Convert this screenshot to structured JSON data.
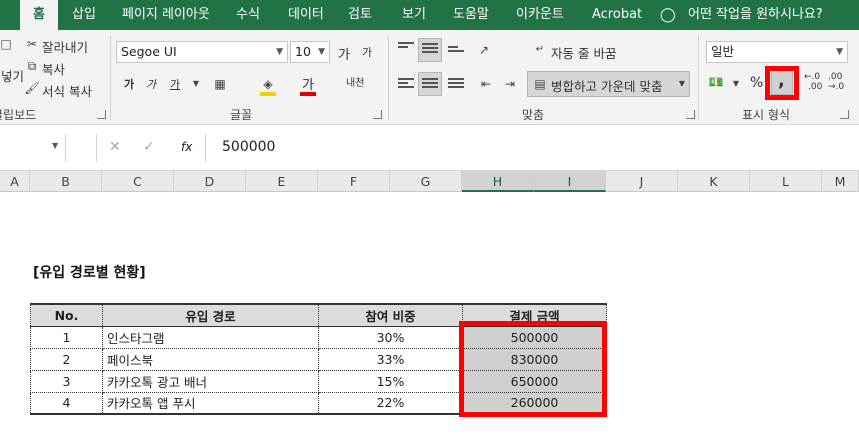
{
  "tabs": [
    "홈",
    "삽입",
    "페이지 레이아웃",
    "수식",
    "데이터",
    "검토",
    "보기",
    "도움말",
    "이카운트",
    "Acrobat"
  ],
  "tell_me": "어떤 작업을 원하시나요?",
  "clipboard": {
    "cut": "잘라내기",
    "copy": "복사",
    "format_painter": "서식 복사",
    "paste_fragment": "붙여넣기",
    "group": "클립보드"
  },
  "font": {
    "name": "Segoe UI",
    "size": "10",
    "grow": "가",
    "shrink": "가",
    "bold": "가",
    "italic": "가",
    "underline": "가",
    "color_char": "가",
    "phonetic": "내천",
    "group": "글꼴"
  },
  "alignment": {
    "wrap": "자동 줄 바꿈",
    "merge": "병합하고 가운데 맞춤",
    "group": "맞춤"
  },
  "number": {
    "format": "일반",
    "percent": "%",
    "comma": ",",
    "inc_decimal_top": "←.0",
    "inc_decimal_bottom": ".00",
    "dec_decimal_top": ".00",
    "dec_decimal_bottom": "→.0",
    "group": "표시 형식"
  },
  "formula_bar": {
    "value": "500000",
    "fx": "fx"
  },
  "columns": [
    "A",
    "B",
    "C",
    "D",
    "E",
    "F",
    "G",
    "H",
    "I",
    "J",
    "K",
    "L",
    "M"
  ],
  "sheet": {
    "title": "[유입 경로별 현황]",
    "headers": [
      "No.",
      "유입 경로",
      "참여 비중",
      "결제 금액"
    ],
    "rows": [
      [
        "1",
        "인스타그램",
        "30%",
        "500000"
      ],
      [
        "2",
        "페이스북",
        "33%",
        "830000"
      ],
      [
        "3",
        "카카오톡 광고 배너",
        "15%",
        "650000"
      ],
      [
        "4",
        "카카오톡 앱 푸시",
        "22%",
        "260000"
      ]
    ]
  },
  "colors": {
    "ribbon_green": "#217346",
    "highlight": "#ff0000",
    "selection": "#cfcfcf"
  }
}
